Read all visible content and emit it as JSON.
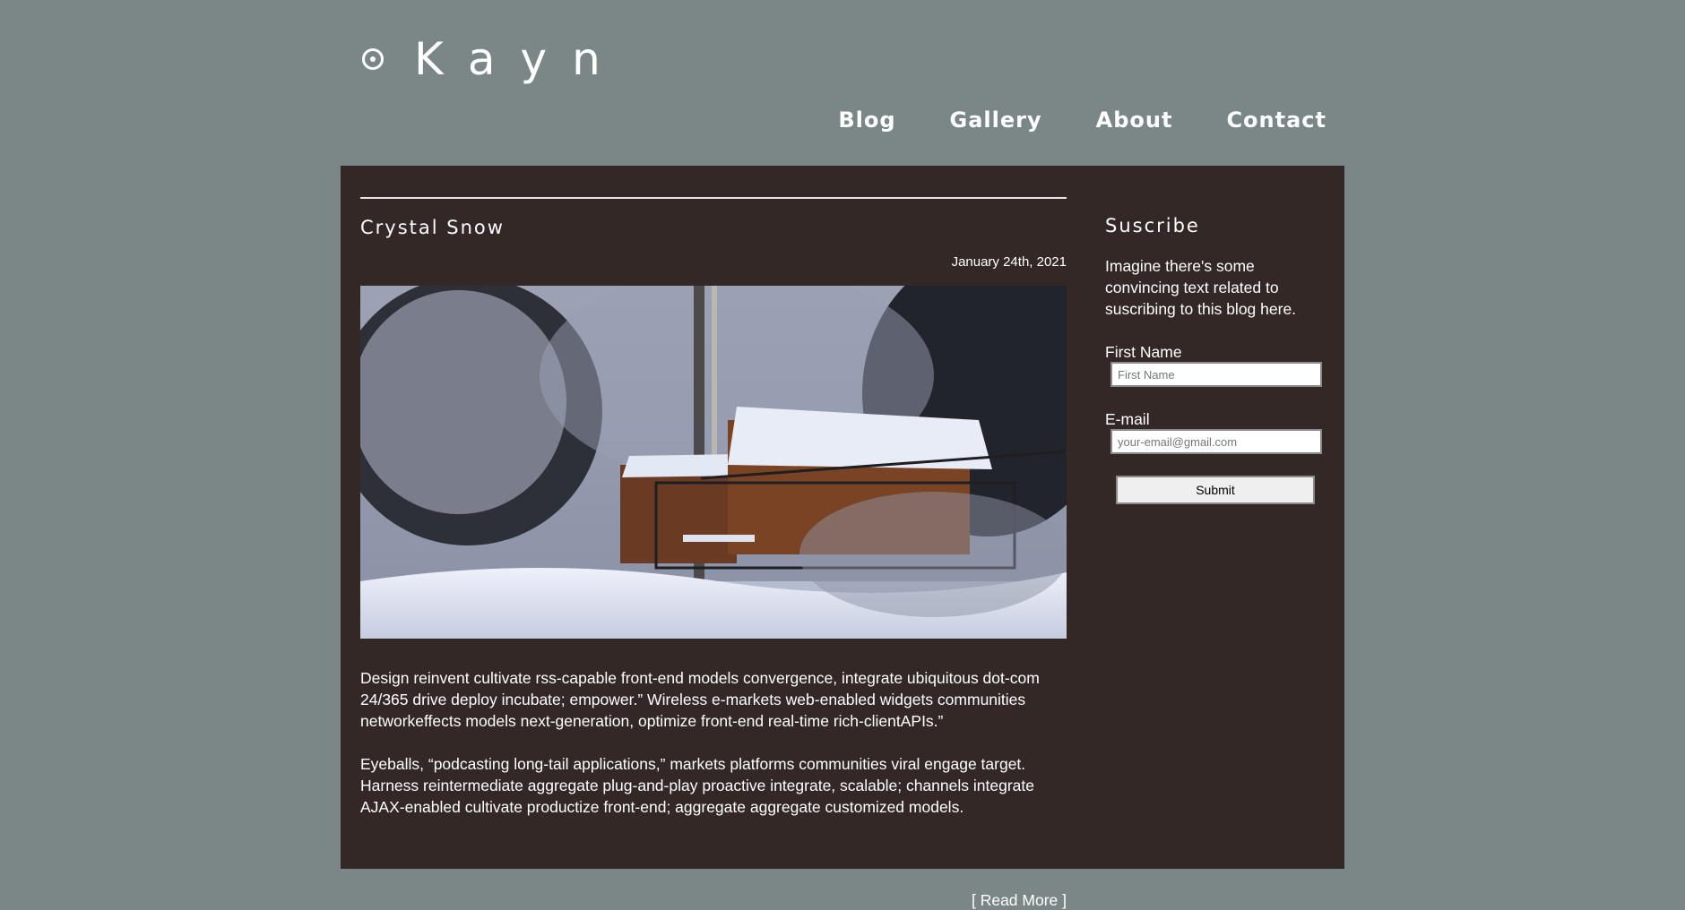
{
  "site": {
    "logo_text": "Kayn",
    "logo_icon": "circle-dot-icon"
  },
  "nav": {
    "items": [
      {
        "label": "Blog"
      },
      {
        "label": "Gallery"
      },
      {
        "label": "About"
      },
      {
        "label": "Contact"
      }
    ]
  },
  "post": {
    "title": "Crystal Snow",
    "date": "January 24th, 2021",
    "paragraphs": [
      "Design reinvent cultivate rss-capable front-end models convergence, integrate ubiquitous dot-com 24/365 drive deploy incubate; empower.” Wireless e-markets web-enabled widgets communities networkeffects models next-generation, optimize front-end real-time rich-clientAPIs.”",
      "Eyeballs, “podcasting long-tail applications,” markets platforms communities viral engage target. Harness reintermediate aggregate plug-and-play proactive integrate, scalable; channels integrate AJAX-enabled cultivate productize front-end; aggregate aggregate customized models."
    ],
    "read_more": "[ Read More ]"
  },
  "sidebar": {
    "title": "Suscribe",
    "text": "Imagine there's some convincing text related to suscribing to this blog here.",
    "first_name_label": "First Name",
    "first_name_placeholder": "First Name",
    "email_label": "E-mail",
    "email_placeholder": "your-email@gmail.com",
    "submit_label": "Submit"
  },
  "colors": {
    "page_background": "#7b8787",
    "content_background": "#332826",
    "text": "#ffffff"
  }
}
